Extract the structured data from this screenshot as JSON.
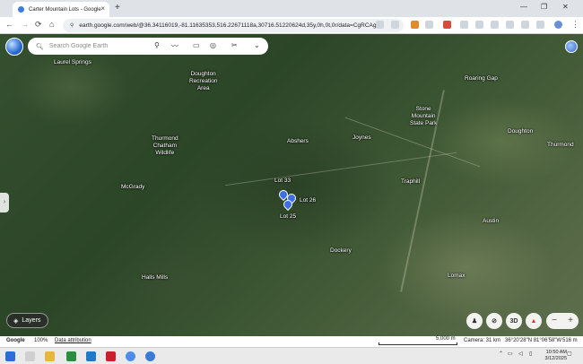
{
  "browser": {
    "tab_title": "Carter Mountain Lots - Google",
    "tab_close": "×",
    "new_tab": "+",
    "url": "earth.google.com/web/@36.34116019,-81.11635353,516.22671118a,30716.51220624d,35y,0h,0t,0r/data=CgRCAgg...",
    "window_controls": [
      "—",
      "❐",
      "✕"
    ]
  },
  "earth": {
    "search_placeholder": "Search Google Earth",
    "side_handle": "›",
    "layers_label": "Layers",
    "controls": [
      "3D",
      "−",
      "+"
    ],
    "places": [
      {
        "name": "Laurel Springs"
      },
      {
        "name": "Doughton\nRecreation\nArea"
      },
      {
        "name": "Roaring Gap"
      },
      {
        "name": "Stone\nMountain\nState Park"
      },
      {
        "name": "Doughton"
      },
      {
        "name": "Thurmond"
      },
      {
        "name": "Thurmond\nChatham\nWildlife"
      },
      {
        "name": "Abshers"
      },
      {
        "name": "Joynes"
      },
      {
        "name": "McGrady"
      },
      {
        "name": "Traphill"
      },
      {
        "name": "Austin"
      },
      {
        "name": "Dockery"
      },
      {
        "name": "Halls Mills"
      },
      {
        "name": "Lomax"
      }
    ],
    "lots": [
      {
        "name": "Lot 33"
      },
      {
        "name": "Lot 26"
      },
      {
        "name": "Lot 25"
      }
    ]
  },
  "status": {
    "brand": "Google",
    "zoom": "100%",
    "attribution": "Data attribution",
    "scale": "5,000 m",
    "camera": "Camera: 31 km",
    "coords": "36°20'28\"N 81°06'58\"W",
    "elevation": "516 m"
  },
  "taskbar": {
    "time": "10:50 AM",
    "date": "3/12/2025"
  }
}
